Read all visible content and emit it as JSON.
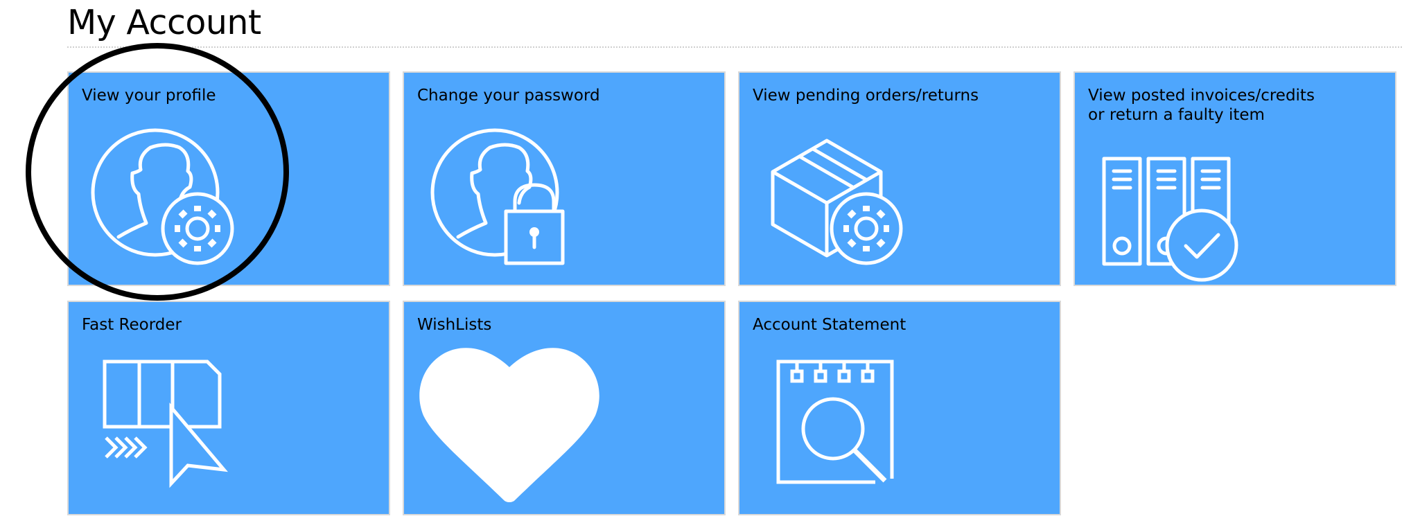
{
  "page": {
    "title": "My Account"
  },
  "tiles": [
    {
      "label": "View your profile",
      "icon": "user-gear-icon"
    },
    {
      "label": "Change your password",
      "icon": "user-lock-icon"
    },
    {
      "label": "View pending orders/returns",
      "icon": "box-gear-icon"
    },
    {
      "label_line1": "View posted invoices/credits",
      "label_line2": "or return a faulty item",
      "icon": "binders-check-icon"
    },
    {
      "label": "Fast Reorder",
      "icon": "reorder-cursor-icon"
    },
    {
      "label": "WishLists",
      "icon": "heart-icon"
    },
    {
      "label": "Account Statement",
      "icon": "notepad-search-icon"
    }
  ],
  "colors": {
    "tile_background": "#4ea6fd",
    "tile_border": "#d9d9d9",
    "icon_stroke": "#ffffff",
    "highlight_ring": "#000000"
  }
}
